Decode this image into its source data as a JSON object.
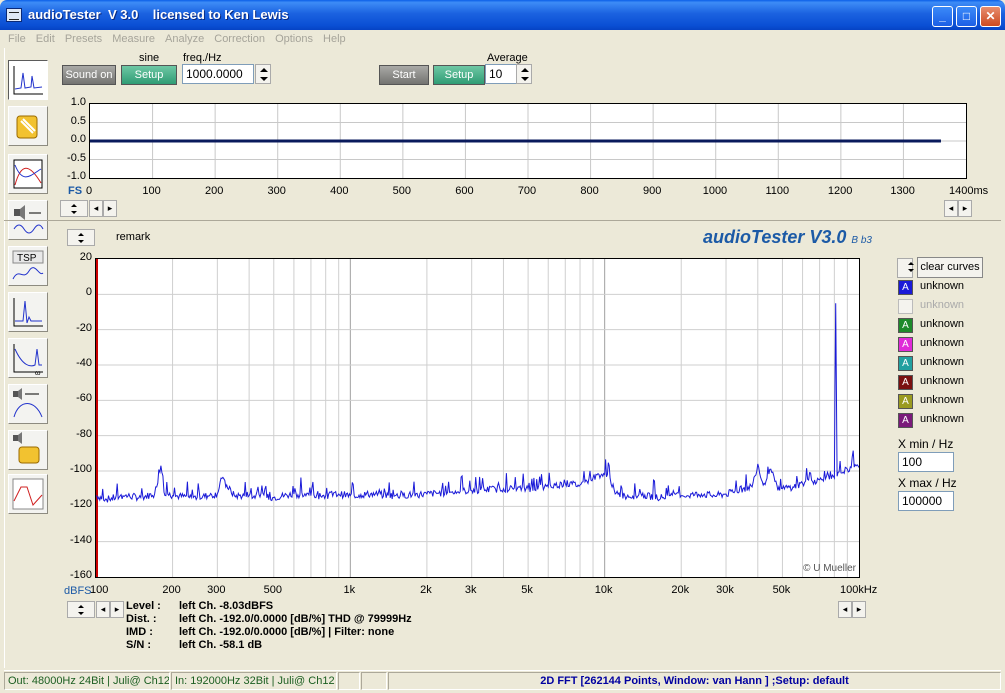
{
  "window": {
    "title": "audioTester  V 3.0    licensed to Ken Lewis"
  },
  "menu": [
    "File",
    "Edit",
    "Presets",
    "Measure",
    "Analyze",
    "Correction",
    "Options",
    "Help"
  ],
  "toolbar": {
    "sound_on": "Sound on",
    "sine_label": "sine",
    "gen_setup": "Setup",
    "freq_label": "freq./Hz",
    "freq_value": "1000.0000",
    "start": "Start",
    "avg_setup": "Setup",
    "average_label": "Average",
    "average_value": "10"
  },
  "scope": {
    "y_ticks": [
      "1.0",
      "0.5",
      "0.0",
      "-0.5",
      "-1.0"
    ],
    "y_axis_label": "FS",
    "x_ticks": [
      "0",
      "100",
      "200",
      "300",
      "400",
      "500",
      "600",
      "700",
      "800",
      "900",
      "1000",
      "1100",
      "1200",
      "1300"
    ],
    "x_unit": "1400ms",
    "trace_color": "#0a1a5c"
  },
  "spectrum": {
    "remark": "remark",
    "brand": "audioTester V3.0",
    "brand_sub": "B b3",
    "copyright": "© U Mueller",
    "y_unit": "dBFS",
    "clear_curves": "clear curves",
    "curves": [
      {
        "letter": "A",
        "label": "unknown",
        "color": "#1a1ad8"
      },
      {
        "letter": "",
        "label": "unknown",
        "color": "#f4f3ee"
      },
      {
        "letter": "A",
        "label": "unknown",
        "color": "#1e8a2a"
      },
      {
        "letter": "A",
        "label": "unknown",
        "color": "#e02ad8"
      },
      {
        "letter": "A",
        "label": "unknown",
        "color": "#22a0a0"
      },
      {
        "letter": "A",
        "label": "unknown",
        "color": "#7a1010"
      },
      {
        "letter": "A",
        "label": "unknown",
        "color": "#9a9a20"
      },
      {
        "letter": "A",
        "label": "unknown",
        "color": "#7a1a7a"
      }
    ],
    "xmin_label": "X min / Hz",
    "xmin_value": "100",
    "xmax_label": "X max / Hz",
    "xmax_value": "100000",
    "trace_color": "#1a1ad8"
  },
  "measurements": {
    "level_label": "Level :",
    "level_value": "left Ch. -8.03dBFS",
    "dist_label": "Dist. :",
    "dist_value": "left Ch. -192.0/0.0000 [dB/%] THD @ 79999Hz",
    "imd_label": "IMD :",
    "imd_value": "left Ch. -192.0/0.0000 [dB/%]  |   Filter: none",
    "sn_label": "S/N :",
    "sn_value": "left Ch. -58.1 dB"
  },
  "status": {
    "out": "Out: 48000Hz 24Bit  | Juli@ Ch12",
    "in": "In: 192000Hz 32Bit  | Juli@ Ch12",
    "fft": "2D FFT [262144 Points, Window: van Hann ]  ;Setup:  default"
  },
  "chart_data": [
    {
      "type": "line",
      "xlabel": "",
      "ylabel": "FS",
      "xlim": [
        0,
        1400
      ],
      "ylim": [
        -1.0,
        1.0
      ],
      "series": [
        {
          "x": [
            0,
            1360
          ],
          "values": [
            0.0,
            0.0
          ]
        }
      ]
    },
    {
      "type": "line",
      "xscale": "log",
      "xlim": [
        100,
        100000
      ],
      "ylim": [
        -160,
        20
      ],
      "ylabel": "dBFS",
      "x_ticks": [
        "100",
        "200",
        "300",
        "500",
        "1k",
        "2k",
        "3k",
        "5k",
        "10k",
        "20k",
        "30k",
        "50k",
        "100kHz"
      ],
      "y_ticks": [
        "20",
        "0",
        "-20",
        "-40",
        "-60",
        "-80",
        "-100",
        "-120",
        "-140",
        "-160"
      ],
      "series": [
        {
          "x": [
            100,
            110,
            130,
            150,
            170,
            180,
            185,
            200,
            250,
            300,
            310,
            350,
            400,
            500,
            600,
            700,
            800,
            900,
            1000,
            1200,
            1500,
            2000,
            2500,
            3000,
            4000,
            5000,
            6000,
            7000,
            8000,
            9000,
            9500,
            10000,
            10500,
            11000,
            12000,
            14000,
            17000,
            20000,
            24000,
            27000,
            30000,
            32000,
            35000,
            38000,
            40000,
            42000,
            45000,
            48000,
            50000,
            55000,
            60000,
            70000,
            80000,
            81000,
            82000,
            85000,
            90000,
            100000
          ],
          "values": [
            -114,
            -116,
            -114,
            -115,
            -113,
            -97,
            -112,
            -114,
            -115,
            -113,
            -104,
            -114,
            -114,
            -115,
            -113,
            -114,
            -114,
            -113,
            -114,
            -113,
            -114,
            -113,
            -112,
            -111,
            -110,
            -110,
            -109,
            -107,
            -108,
            -104,
            -102,
            -102,
            -104,
            -113,
            -114,
            -114,
            -115,
            -114,
            -113,
            -114,
            -113,
            -112,
            -110,
            -109,
            -96,
            -108,
            -99,
            -111,
            -110,
            -109,
            -107,
            -105,
            -104,
            -5,
            -103,
            -101,
            -99,
            -98
          ]
        }
      ]
    }
  ]
}
